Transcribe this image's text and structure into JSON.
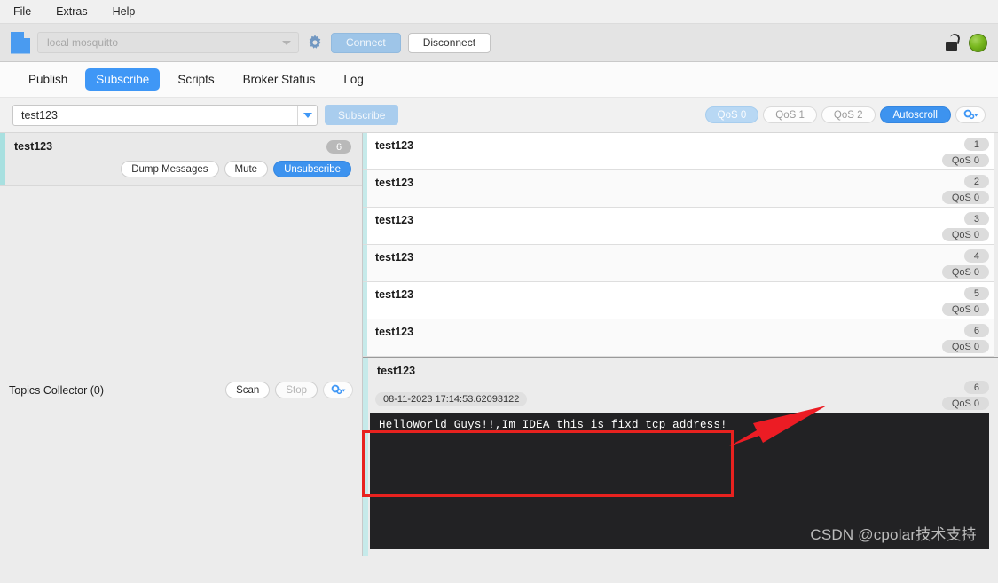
{
  "menubar": {
    "items": [
      {
        "label": "File"
      },
      {
        "label": "Extras"
      },
      {
        "label": "Help"
      }
    ]
  },
  "connection": {
    "doc_icon": "document-icon",
    "broker_value": "local mosquitto",
    "broker_placeholder": "local mosquitto",
    "gear_icon": "gear-icon",
    "connect_label": "Connect",
    "disconnect_label": "Disconnect",
    "lock_icon": "unlocked-padlock-icon",
    "status_led": "connected-green",
    "accent_color": "#3f97f6",
    "led_color": "#79b81f"
  },
  "tabs": [
    {
      "label": "Publish",
      "active": false
    },
    {
      "label": "Subscribe",
      "active": true
    },
    {
      "label": "Scripts",
      "active": false
    },
    {
      "label": "Broker Status",
      "active": false
    },
    {
      "label": "Log",
      "active": false
    }
  ],
  "subscribe_bar": {
    "topic_value": "test123",
    "topic_placeholder": "Topic",
    "dropdown_icon": "chevron-down-icon",
    "subscribe_label": "Subscribe",
    "qos": [
      {
        "label": "QoS 0",
        "selected": true
      },
      {
        "label": "QoS 1",
        "selected": false
      },
      {
        "label": "QoS 2",
        "selected": false
      }
    ],
    "autoscroll_label": "Autoscroll",
    "settings_icon": "settings-gears-dropdown-icon"
  },
  "topic_panel": {
    "topic": "test123",
    "count": "6",
    "dump_label": "Dump Messages",
    "mute_label": "Mute",
    "unsubscribe_label": "Unsubscribe"
  },
  "collector": {
    "title": "Topics Collector (0)",
    "scan_label": "Scan",
    "stop_label": "Stop",
    "settings_icon": "settings-gears-dropdown-icon"
  },
  "messages": [
    {
      "topic": "test123",
      "index": "1",
      "qos": "QoS 0"
    },
    {
      "topic": "test123",
      "index": "2",
      "qos": "QoS 0"
    },
    {
      "topic": "test123",
      "index": "3",
      "qos": "QoS 0"
    },
    {
      "topic": "test123",
      "index": "4",
      "qos": "QoS 0"
    },
    {
      "topic": "test123",
      "index": "5",
      "qos": "QoS 0"
    },
    {
      "topic": "test123",
      "index": "6",
      "qos": "QoS 0"
    }
  ],
  "detail": {
    "topic": "test123",
    "index": "6",
    "qos": "QoS 0",
    "timestamp": "08-11-2023  17:14:53.62093122",
    "payload": "HelloWorld Guys!!,Im IDEA this is fixd tcp address!",
    "watermark": "CSDN @cpolar技术支持"
  },
  "annotations": {
    "highlight_color": "#e8221f",
    "arrow_icon": "red-arrow-pointing-left"
  }
}
